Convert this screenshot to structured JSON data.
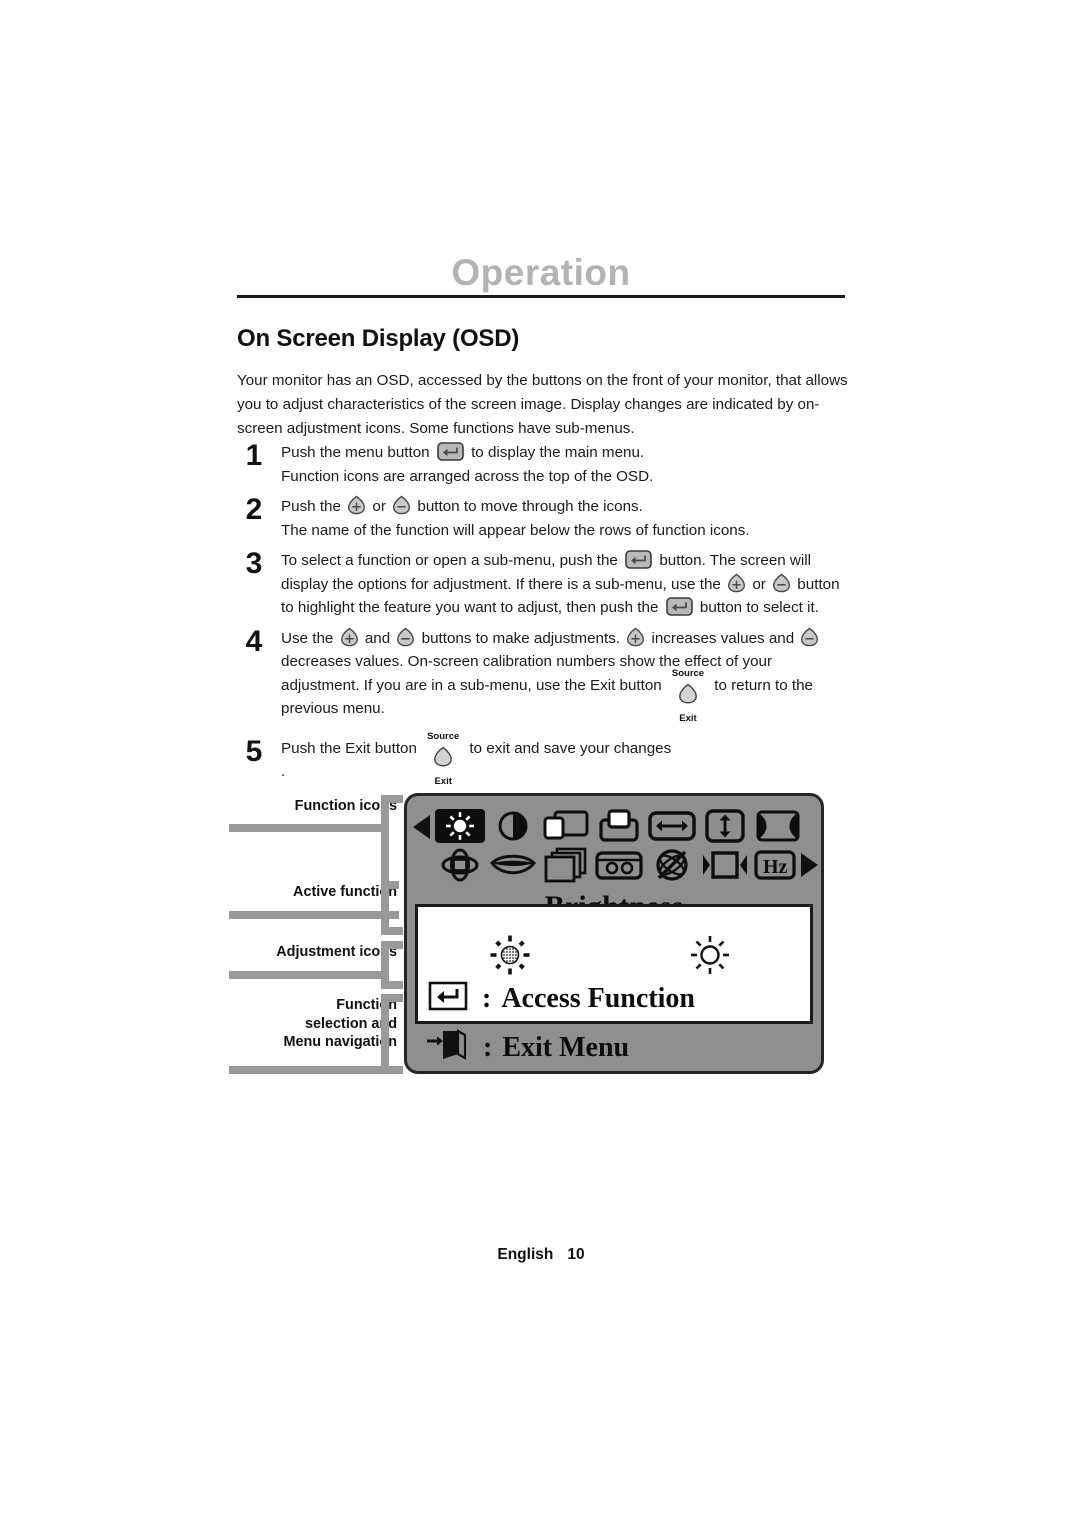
{
  "header": {
    "chapter_title": "Operation",
    "section_heading": "On Screen Display (OSD)"
  },
  "intro": {
    "text": "Your monitor has an OSD, accessed by the buttons on the front of your monitor, that allows you to adjust characteristics of the screen image. Display changes are indicated by on-screen adjustment icons. Some functions have sub-menus."
  },
  "steps": [
    {
      "number": "1",
      "part_a": "Push the menu button",
      "part_b": "to display the main menu.",
      "line2": "Function icons are arranged across the top of the OSD."
    },
    {
      "number": "2",
      "part_a": "Push the",
      "part_b": "or",
      "part_c": "button to move through the icons.",
      "line2": "The name of the function will appear below the rows of function icons."
    },
    {
      "number": "3",
      "part_a": "To select a function or open a sub-menu, push the",
      "part_b": "button. The screen will display the options for adjustment. If there is a sub-menu, use the",
      "part_c": "or",
      "part_d": "button to highlight the feature you want to adjust, then push the",
      "part_e": "button to select it."
    },
    {
      "number": "4",
      "part_a": "Use the",
      "part_b": "and",
      "part_c": "buttons to make adjustments.",
      "part_d": "increases values and",
      "part_e": "decreases values. On-screen calibration numbers show the effect of your adjustment. If you are in a sub-menu, use the Exit button",
      "part_f": "to return to the previous menu."
    },
    {
      "number": "5",
      "part_a": "Push the Exit button",
      "part_b": "to exit and save your changes",
      "line2": "."
    }
  ],
  "buttons": {
    "menu_icon": "enter-arrow-icon",
    "plus_icon": "plus-button-icon",
    "minus_icon": "minus-button-icon",
    "source_label": "Source",
    "exit_label": "Exit",
    "source_exit_icon": "source-exit-button-icon"
  },
  "callouts": [
    {
      "label": "Function icons"
    },
    {
      "label": "Active function"
    },
    {
      "label": "Adjustment icons"
    },
    {
      "label": "Function\nselection and\nMenu navigation"
    }
  ],
  "osd": {
    "active_function": "Brightness",
    "access_label": "Access Function",
    "exit_label": "Exit Menu",
    "colon": ":",
    "function_icons_row1": [
      "brightness-icon",
      "contrast-icon",
      "horizontal-position-icon",
      "vertical-position-icon",
      "horizontal-size-icon",
      "vertical-size-icon",
      "pincushion-icon"
    ],
    "function_icons_row2": [
      "rotation-icon",
      "trapezoid-icon",
      "parallelogram-icon",
      "pinbalance-icon",
      "degauss-icon",
      "zoom-icon",
      "frequency-hz-icon"
    ],
    "hz_label": "Hz",
    "adjustment_icons": [
      "brightness-decrease-icon",
      "brightness-increase-icon"
    ],
    "access_icon": "enter-arrow-boxed-icon",
    "exit_icon": "exit-door-icon",
    "panel_color": "#8f8f8f",
    "panel_border": "#262626",
    "highlight_color": "#111111"
  },
  "footer": {
    "language": "English",
    "page": "10"
  }
}
